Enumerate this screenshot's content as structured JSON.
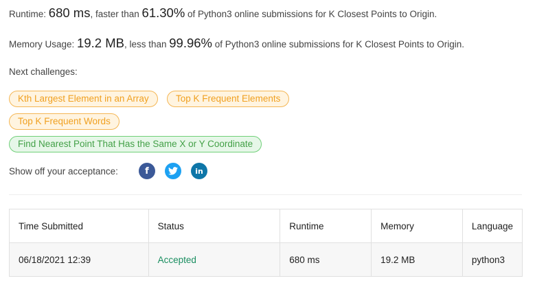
{
  "runtime": {
    "label": "Runtime:",
    "value": "680 ms",
    "mid": ", faster than",
    "percent": "61.30%",
    "tail": "of Python3 online submissions for K Closest Points to Origin."
  },
  "memory": {
    "label": "Memory Usage:",
    "value": "19.2 MB",
    "mid": ", less than",
    "percent": "99.96%",
    "tail": "of Python3 online submissions for K Closest Points to Origin."
  },
  "next_label": "Next challenges:",
  "challenges": [
    {
      "label": "Kth Largest Element in an Array",
      "difficulty": "medium"
    },
    {
      "label": "Top K Frequent Elements",
      "difficulty": "medium"
    },
    {
      "label": "Top K Frequent Words",
      "difficulty": "medium"
    },
    {
      "label": "Find Nearest Point That Has the Same X or Y Coordinate",
      "difficulty": "easy"
    }
  ],
  "share": {
    "label": "Show off your acceptance:",
    "icons": [
      "facebook-icon",
      "twitter-icon",
      "linkedin-icon"
    ]
  },
  "table": {
    "headers": [
      "Time Submitted",
      "Status",
      "Runtime",
      "Memory",
      "Language"
    ],
    "rows": [
      [
        "06/18/2021 12:39",
        "Accepted",
        "680 ms",
        "19.2 MB",
        "python3"
      ]
    ]
  },
  "colors": {
    "medium_chip": "#f0a020",
    "easy_chip": "#43a047",
    "accepted": "#1a8e60",
    "facebook": "#3b5998",
    "twitter": "#1da1f2",
    "linkedin": "#0e76a8"
  }
}
